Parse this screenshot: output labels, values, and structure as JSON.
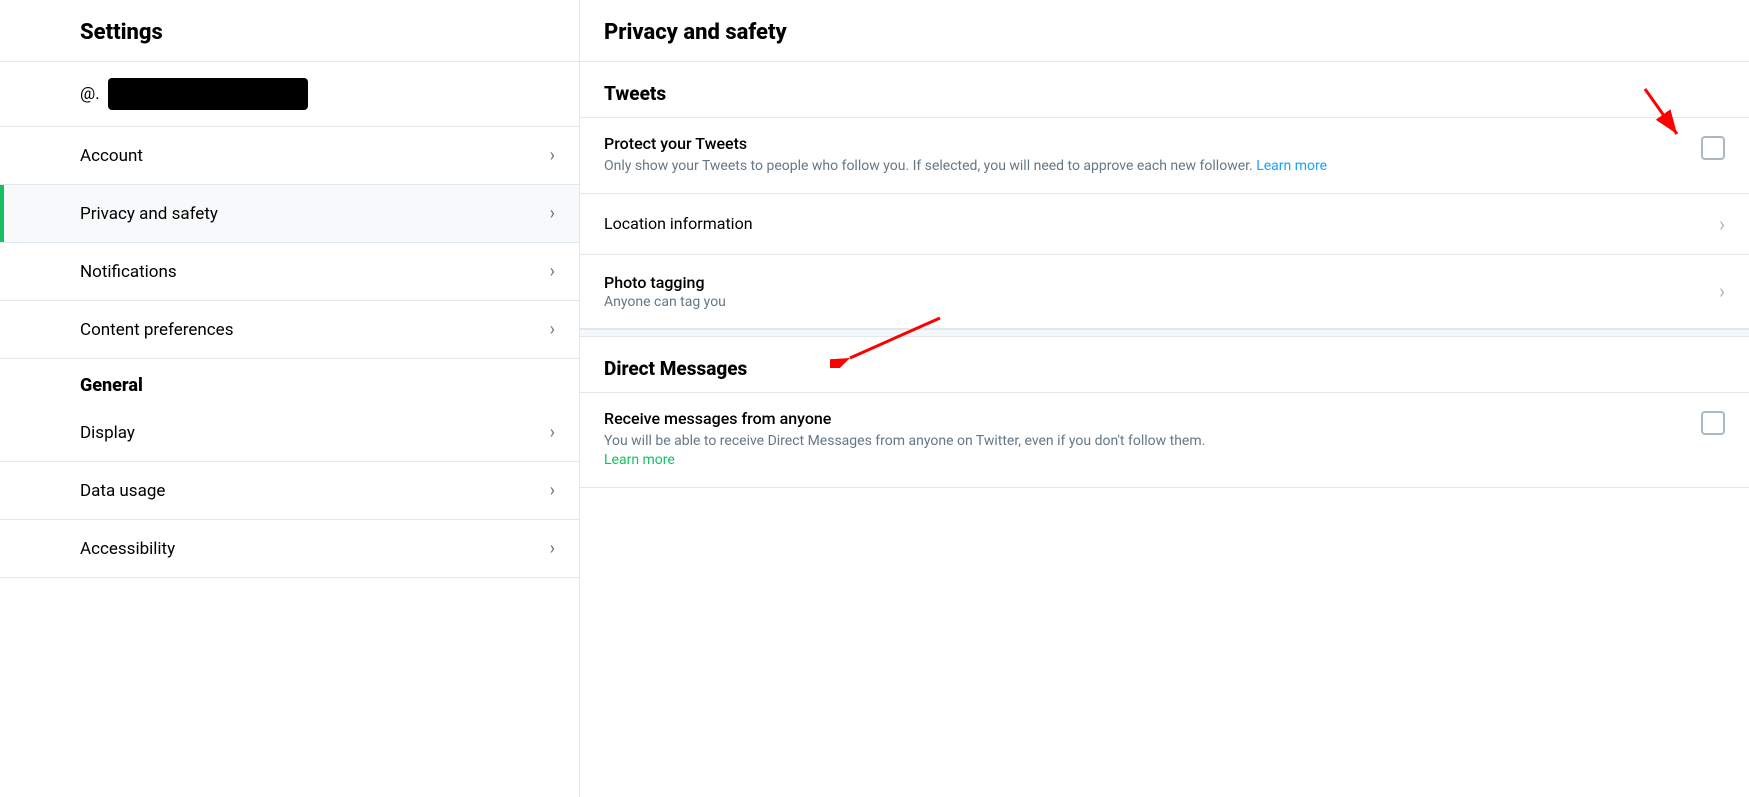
{
  "sidebar": {
    "title": "Settings",
    "username_at": "@.",
    "sections": [
      {
        "type": "items",
        "items": [
          {
            "id": "account",
            "label": "Account",
            "active": false
          },
          {
            "id": "privacy-safety",
            "label": "Privacy and safety",
            "active": true
          },
          {
            "id": "notifications",
            "label": "Notifications",
            "active": false
          },
          {
            "id": "content-preferences",
            "label": "Content preferences",
            "active": false
          }
        ]
      },
      {
        "type": "header",
        "label": "General"
      },
      {
        "type": "items",
        "items": [
          {
            "id": "display",
            "label": "Display",
            "active": false
          },
          {
            "id": "data-usage",
            "label": "Data usage",
            "active": false
          },
          {
            "id": "accessibility",
            "label": "Accessibility",
            "active": false
          }
        ]
      }
    ]
  },
  "main": {
    "page_title": "Privacy and safety",
    "sections": [
      {
        "id": "tweets",
        "title": "Tweets",
        "items": [
          {
            "id": "protect-tweets",
            "type": "checkbox",
            "label": "Protect your Tweets",
            "desc": "Only show your Tweets to people who follow you. If selected, you will need to approve each new follower.",
            "link_label": "Learn more",
            "checked": false
          },
          {
            "id": "location-information",
            "type": "nav",
            "label": "Location information",
            "sublabel": ""
          },
          {
            "id": "photo-tagging",
            "type": "nav",
            "label": "Photo tagging",
            "sublabel": "Anyone can tag you"
          }
        ]
      },
      {
        "id": "direct-messages",
        "title": "Direct Messages",
        "items": [
          {
            "id": "receive-messages",
            "type": "checkbox",
            "label": "Receive messages from anyone",
            "desc": "You will be able to receive Direct Messages from anyone on Twitter, even if you don't follow them.",
            "link_label": "Learn more",
            "checked": false
          }
        ]
      }
    ]
  }
}
